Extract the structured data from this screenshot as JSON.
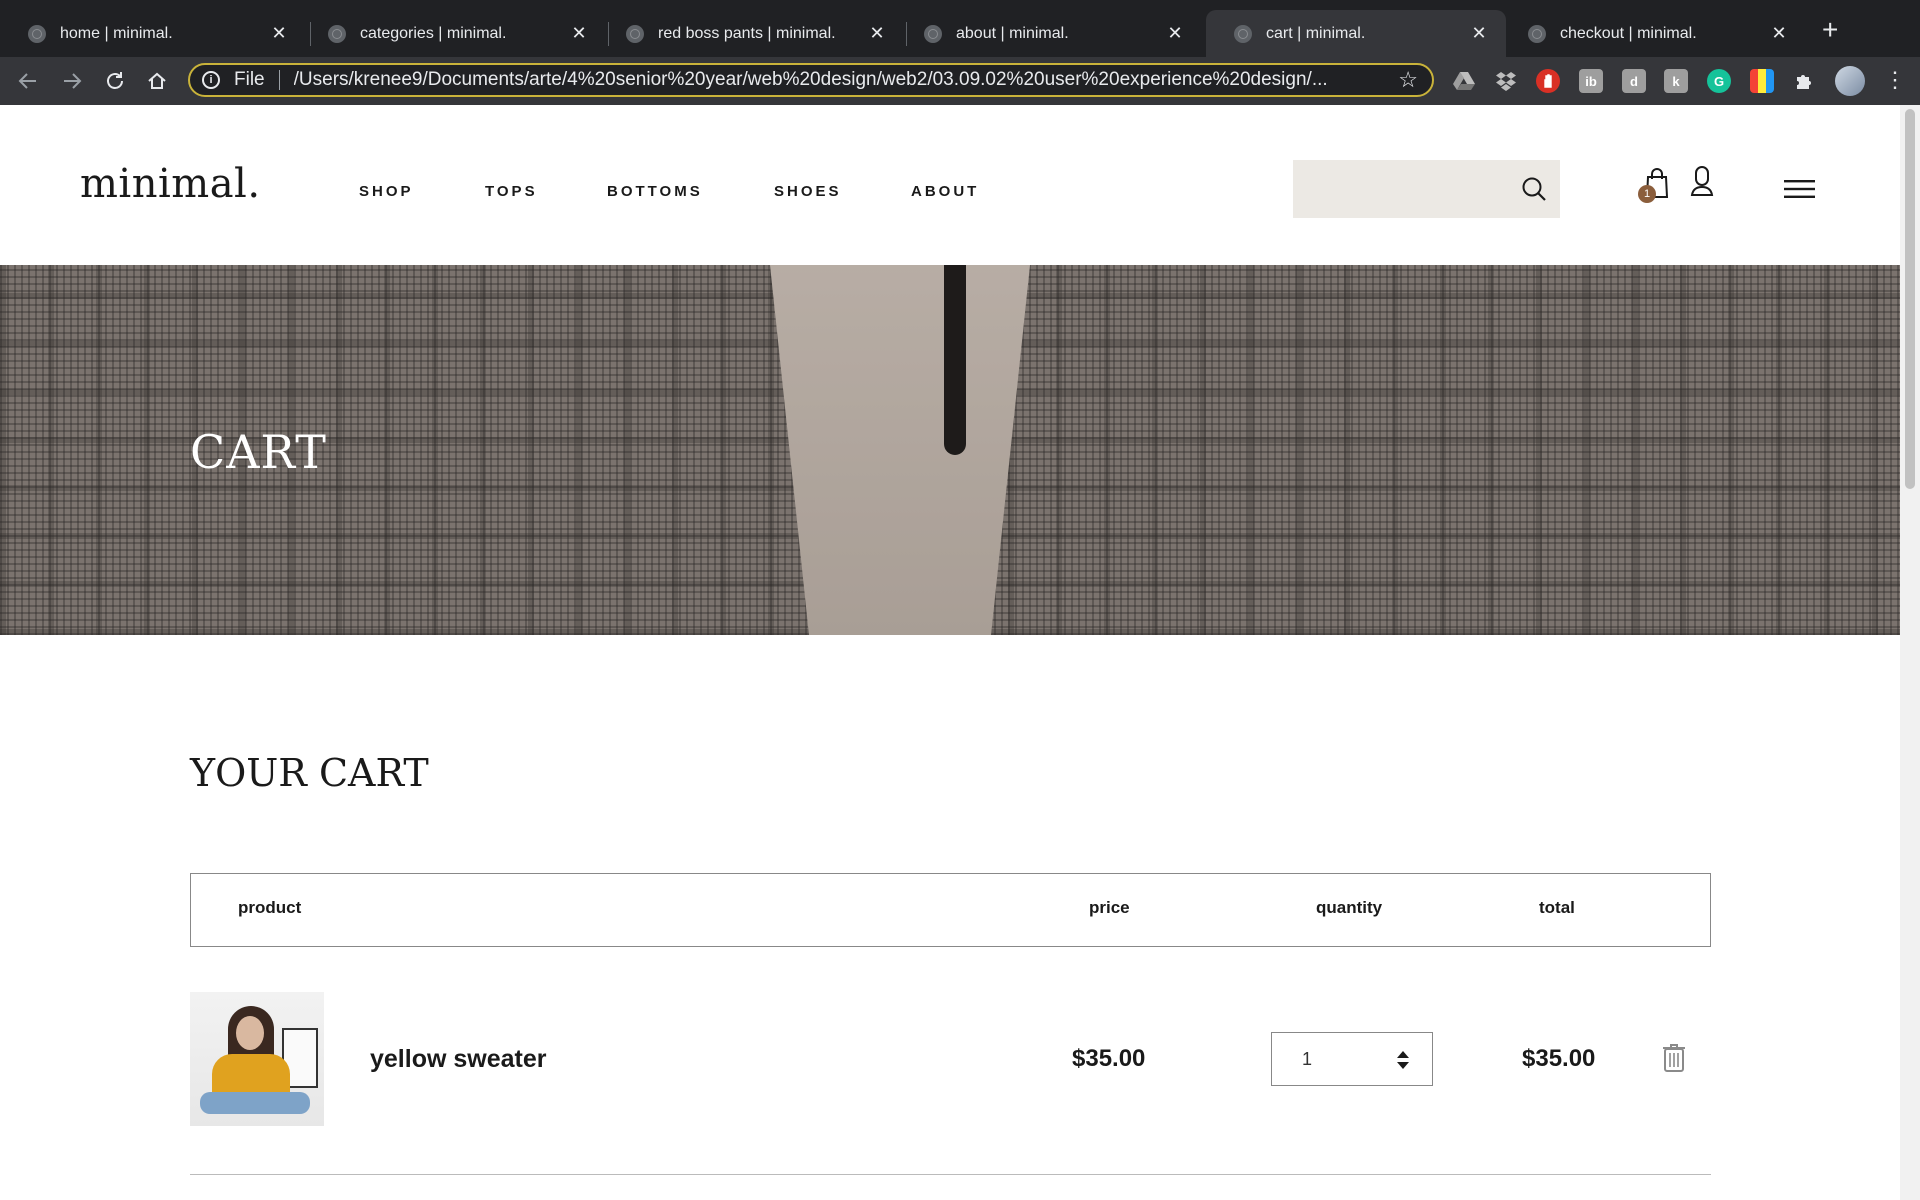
{
  "browser": {
    "tabs": [
      {
        "label": "home | minimal."
      },
      {
        "label": "categories | minimal."
      },
      {
        "label": "red boss pants | minimal."
      },
      {
        "label": "about | minimal."
      },
      {
        "label": "cart | minimal.",
        "active": true
      },
      {
        "label": "checkout | minimal."
      }
    ],
    "tab_close": "✕",
    "new_tab": "+",
    "scheme_label": "File",
    "url": "/Users/krenee9/Documents/arte/4%20senior%20year/web%20design/web2/03.09.02%20user%20experience%20design/...",
    "extensions": [
      "drive",
      "dropbox",
      "adblock",
      "ib",
      "dlogo",
      "k",
      "grammarly",
      "palette",
      "puzzle"
    ]
  },
  "site": {
    "logo": "minimal.",
    "nav": [
      "SHOP",
      "TOPS",
      "BOTTOMS",
      "SHOES",
      "ABOUT"
    ],
    "search_placeholder": "",
    "cart_count": "1",
    "accent": "#8b5e3c",
    "search_bg": "#ece9e4"
  },
  "hero": {
    "title": "CART"
  },
  "cart": {
    "heading": "YOUR CART",
    "columns": {
      "product": "product",
      "price": "price",
      "quantity": "quantity",
      "total": "total"
    },
    "items": [
      {
        "name": "yellow sweater",
        "price": "$35.00",
        "quantity": "1",
        "total": "$35.00"
      }
    ]
  }
}
